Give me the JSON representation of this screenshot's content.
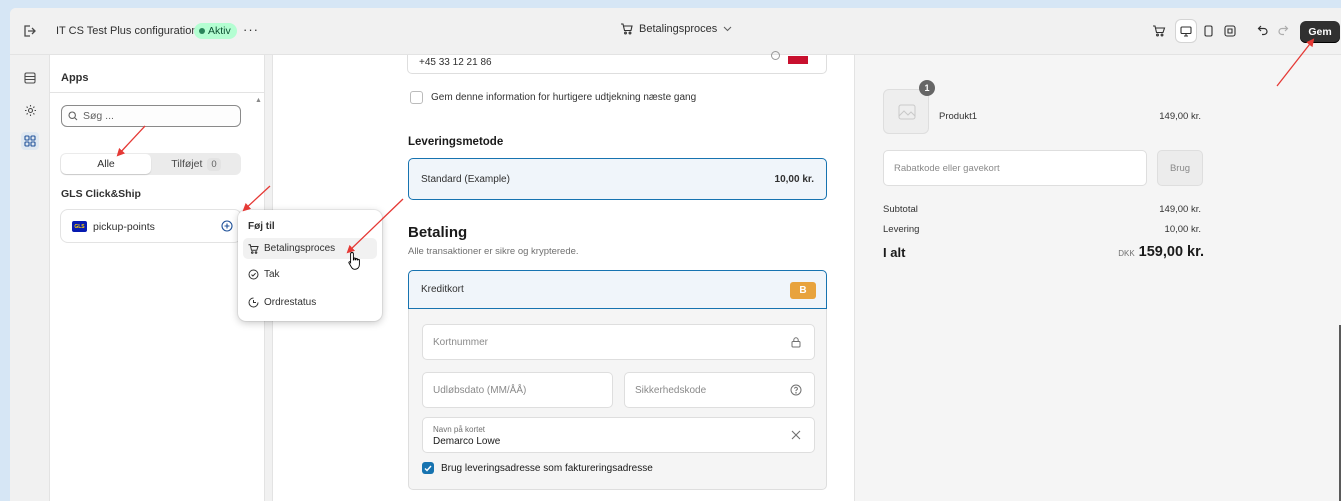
{
  "topbar": {
    "app_title": "IT CS Test Plus configuration",
    "status_badge": "Aktiv",
    "more_label": "···",
    "page_selector": "Betalingsproces",
    "save_label": "Gem"
  },
  "rail": {
    "items": [
      "sections",
      "settings",
      "apps"
    ]
  },
  "sidebar": {
    "heading": "Apps",
    "search_placeholder": "Søg ...",
    "segments": {
      "all": "Alle",
      "added": "Tilføjet",
      "added_count": "0"
    },
    "group_title": "GLS Click&Ship",
    "app_card": {
      "logo_text": "GLS",
      "label": "pickup-points"
    }
  },
  "popover": {
    "title": "Føj til",
    "items": [
      {
        "label": "Betalingsproces",
        "icon": "cart-icon"
      },
      {
        "label": "Tak",
        "icon": "check-circle-icon"
      },
      {
        "label": "Ordrestatus",
        "icon": "order-status-icon"
      }
    ]
  },
  "checkout": {
    "phone_value": "+45 33 12 21 86",
    "save_info_label": "Gem denne information for hurtigere udtjekning næste gang",
    "shipping_heading": "Leveringsmetode",
    "shipping_option": "Standard (Example)",
    "shipping_price": "10,00 kr.",
    "payment_heading": "Betaling",
    "payment_subtext": "Alle transaktioner er sikre og krypterede.",
    "payment_method": "Kreditkort",
    "payment_badge": "B",
    "card_number_placeholder": "Kortnummer",
    "expiry_placeholder": "Udløbsdato (MM/ÅÅ)",
    "cvc_placeholder": "Sikkerhedskode",
    "name_label": "Navn på kortet",
    "name_value": "Demarco Lowe",
    "billing_same_label": "Brug leveringsadresse som faktureringsadresse"
  },
  "summary": {
    "product_qty": "1",
    "product_name": "Produkt1",
    "product_price": "149,00 kr.",
    "discount_placeholder": "Rabatkode eller gavekort",
    "discount_button": "Brug",
    "subtotal_label": "Subtotal",
    "subtotal_value": "149,00 kr.",
    "shipping_label": "Levering",
    "shipping_value": "10,00 kr.",
    "total_label": "I alt",
    "total_currency": "DKK",
    "total_value": "159,00 kr."
  },
  "colors": {
    "accent": "#1773b0",
    "annotation_arrow": "#e53935",
    "save_button": "#303030",
    "badge_green": "#b4fed2"
  }
}
